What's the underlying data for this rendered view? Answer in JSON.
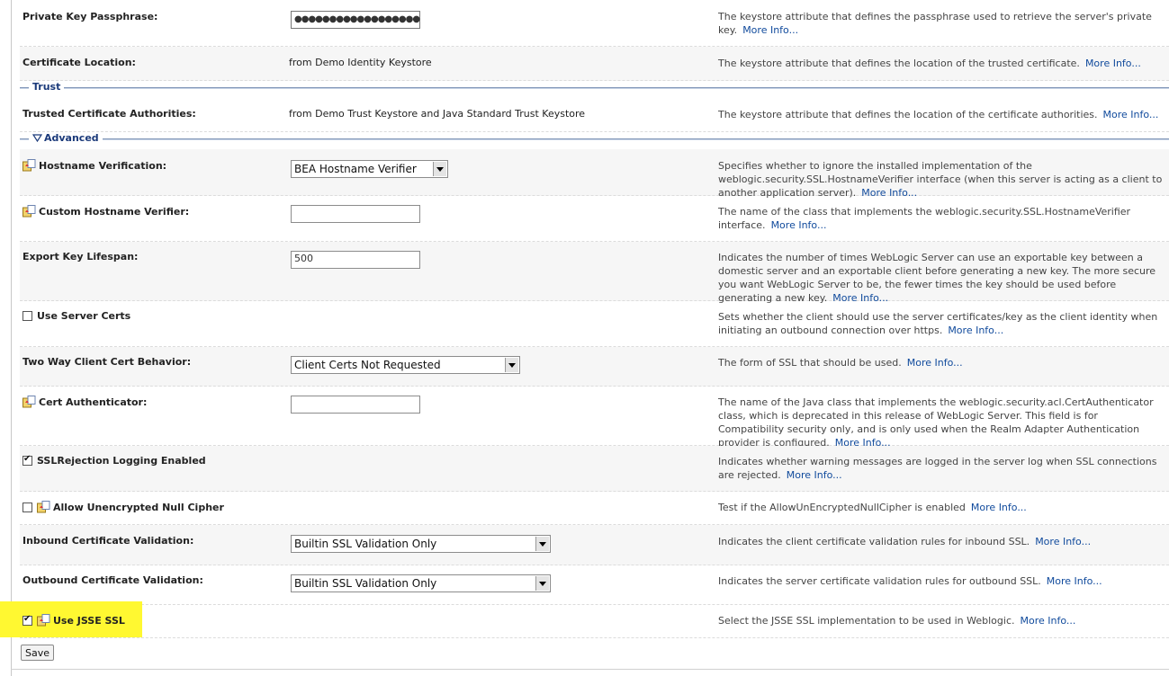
{
  "rows": {
    "private_key_passphrase": {
      "label": "Private Key Passphrase:",
      "value": "●●●●●●●●●●●●●●●●●●",
      "desc": "The keystore attribute that defines the passphrase used to retrieve the server's private key.",
      "more": "More Info..."
    },
    "certificate_location": {
      "label": "Certificate Location:",
      "value": "from Demo Identity Keystore",
      "desc": "The keystore attribute that defines the location of the trusted certificate.",
      "more": "More Info..."
    },
    "trusted_ca": {
      "label": "Trusted Certificate Authorities:",
      "value": "from Demo Trust Keystore and Java Standard Trust Keystore",
      "desc": "The keystore attribute that defines the location of the certificate authorities.",
      "more": "More Info..."
    },
    "hostname_verification": {
      "label": "Hostname Verification:",
      "value": "BEA Hostname Verifier",
      "desc": "Specifies whether to ignore the installed implementation of the weblogic.security.SSL.HostnameVerifier interface (when this server is acting as a client to another application server).",
      "more": "More Info..."
    },
    "custom_hostname_verifier": {
      "label": "Custom Hostname Verifier:",
      "value": "",
      "desc": "The name of the class that implements the weblogic.security.SSL.HostnameVerifier interface.",
      "more": "More Info..."
    },
    "export_key_lifespan": {
      "label": "Export Key Lifespan:",
      "value": "500",
      "desc": "Indicates the number of times WebLogic Server can use an exportable key between a domestic server and an exportable client before generating a new key. The more secure you want WebLogic Server to be, the fewer times the key should be used before generating a new key.",
      "more": "More Info..."
    },
    "use_server_certs": {
      "label": "Use Server Certs",
      "checked": false,
      "desc": "Sets whether the client should use the server certificates/key as the client identity when initiating an outbound connection over https.",
      "more": "More Info..."
    },
    "two_way_client_cert": {
      "label": "Two Way Client Cert Behavior:",
      "value": "Client Certs Not Requested",
      "desc": "The form of SSL that should be used.",
      "more": "More Info..."
    },
    "cert_authenticator": {
      "label": "Cert Authenticator:",
      "value": "",
      "desc": "The name of the Java class that implements the weblogic.security.acl.CertAuthenticator class, which is deprecated in this release of WebLogic Server. This field is for Compatibility security only, and is only used when the Realm Adapter Authentication provider is configured.",
      "more": "More Info..."
    },
    "sslrejection_logging": {
      "label": "SSLRejection Logging Enabled",
      "checked": true,
      "desc": "Indicates whether warning messages are logged in the server log when SSL connections are rejected.",
      "more": "More Info..."
    },
    "allow_unencrypted_null_cipher": {
      "label": "Allow Unencrypted Null Cipher",
      "checked": false,
      "desc": "Test if the AllowUnEncryptedNullCipher is enabled",
      "more": "More Info..."
    },
    "inbound_cert_validation": {
      "label": "Inbound Certificate Validation:",
      "value": "Builtin SSL Validation Only",
      "desc": "Indicates the client certificate validation rules for inbound SSL.",
      "more": "More Info..."
    },
    "outbound_cert_validation": {
      "label": "Outbound Certificate Validation:",
      "value": "Builtin SSL Validation Only",
      "desc": "Indicates the server certificate validation rules for outbound SSL.",
      "more": "More Info..."
    },
    "use_jsse_ssl": {
      "label": "Use JSSE SSL",
      "checked": true,
      "desc": "Select the JSSE SSL implementation to be used in Weblogic.",
      "more": "More Info..."
    }
  },
  "sections": {
    "trust": "Trust",
    "advanced": "Advanced"
  },
  "save_label": "Save",
  "colors": {
    "highlight": "#fff831",
    "link": "#104a9c",
    "section_line": "#7f95b7"
  }
}
